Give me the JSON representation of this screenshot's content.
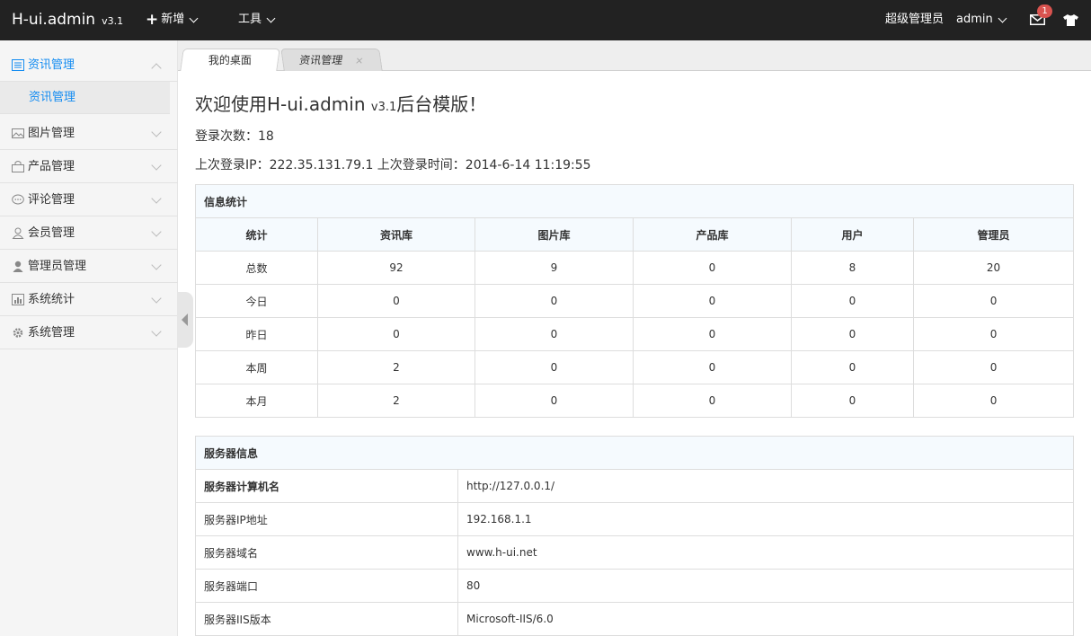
{
  "header": {
    "brand": "H-ui.admin",
    "version": "v3.1",
    "menu_add": "新增",
    "menu_tools": "工具",
    "role": "超级管理员",
    "user": "admin",
    "mail_count": "1"
  },
  "sidebar": {
    "items": [
      {
        "label": "资讯管理"
      },
      {
        "label": "图片管理"
      },
      {
        "label": "产品管理"
      },
      {
        "label": "评论管理"
      },
      {
        "label": "会员管理"
      },
      {
        "label": "管理员管理"
      },
      {
        "label": "系统统计"
      },
      {
        "label": "系统管理"
      }
    ],
    "sub_item": "资讯管理"
  },
  "tabs": {
    "desk": "我的桌面",
    "news": "资讯管理",
    "close": "×"
  },
  "main": {
    "welcome_prefix": "欢迎使用H-ui.admin ",
    "welcome_version": "v3.1",
    "welcome_suffix": "后台模版！",
    "login_count": "登录次数：18",
    "last_login": "上次登录IP：222.35.131.79.1 上次登录时间：2014-6-14 11:19:55"
  },
  "stats": {
    "title": "信息统计",
    "headers": [
      "统计",
      "资讯库",
      "图片库",
      "产品库",
      "用户",
      "管理员"
    ],
    "rows": [
      [
        "总数",
        "92",
        "9",
        "0",
        "8",
        "20"
      ],
      [
        "今日",
        "0",
        "0",
        "0",
        "0",
        "0"
      ],
      [
        "昨日",
        "0",
        "0",
        "0",
        "0",
        "0"
      ],
      [
        "本周",
        "2",
        "0",
        "0",
        "0",
        "0"
      ],
      [
        "本月",
        "2",
        "0",
        "0",
        "0",
        "0"
      ]
    ]
  },
  "server": {
    "title": "服务器信息",
    "rows": [
      [
        "服务器计算机名",
        "http://127.0.0.1/"
      ],
      [
        "服务器IP地址",
        "192.168.1.1"
      ],
      [
        "服务器域名",
        "www.h-ui.net"
      ],
      [
        "服务器端口",
        "80"
      ],
      [
        "服务器IIS版本",
        "Microsoft-IIS/6.0"
      ]
    ]
  },
  "colors": {
    "navbar": "#222222",
    "accent": "#148cf1",
    "badge": "#d9534f"
  }
}
